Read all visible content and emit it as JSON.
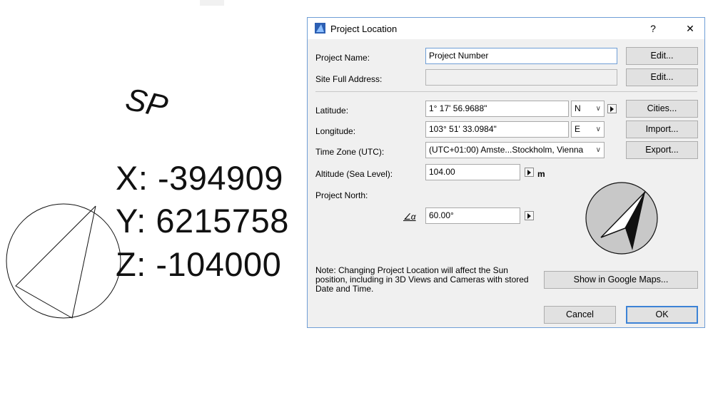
{
  "background": {
    "sp_label": "SP",
    "x_label": "X: -394909",
    "y_label": "Y: 6215758",
    "z_label": "Z: -104000"
  },
  "dialog": {
    "title": "Project Location",
    "help_glyph": "?",
    "close_glyph": "✕",
    "project_name_label": "Project Name:",
    "project_name_value": "Project Number",
    "site_address_label": "Site Full Address:",
    "site_address_value": "",
    "edit_label": "Edit...",
    "latitude_label": "Latitude:",
    "latitude_value": "1° 17' 56.9688\"",
    "latitude_dir": "N",
    "longitude_label": "Longitude:",
    "longitude_value": "103° 51' 33.0984\"",
    "longitude_dir": "E",
    "timezone_label": "Time Zone (UTC):",
    "timezone_value": "(UTC+01:00) Amste...Stockholm, Vienna",
    "altitude_label": "Altitude (Sea Level):",
    "altitude_value": "104.00",
    "altitude_unit": "m",
    "north_label": "Project North:",
    "north_symbol": "∠α",
    "north_value": "60.00°",
    "cities_label": "Cities...",
    "import_label": "Import...",
    "export_label": "Export...",
    "note": "Note: Changing Project Location will affect the Sun position, including in 3D Views and Cameras with stored Date and Time.",
    "maps_label": "Show in Google Maps...",
    "cancel_label": "Cancel",
    "ok_label": "OK",
    "accent": "#3d83d6"
  }
}
